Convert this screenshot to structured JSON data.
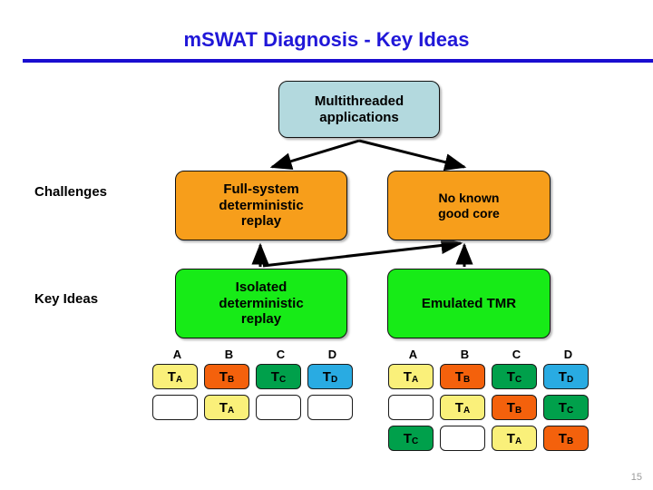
{
  "slide": {
    "title": "mSWAT Diagnosis - Key Ideas",
    "page_number": "15",
    "accent_color": "#2017D8"
  },
  "row_labels": {
    "challenges": "Challenges",
    "key_ideas": "Key Ideas"
  },
  "boxes": {
    "multithreaded": {
      "line1": "Multithreaded",
      "line2": "applications",
      "color": "#B3D9DE"
    },
    "full_system": {
      "line1": "Full-system",
      "line2": "deterministic",
      "line3": "replay",
      "color": "#F79E1B"
    },
    "no_known_core": {
      "line1": "No known",
      "line2": "good core",
      "color": "#F79E1B"
    },
    "isolated": {
      "line1": "Isolated",
      "line2": "deterministic",
      "line3": "replay",
      "color": "#17EB17"
    },
    "emulated_tmr": {
      "line1": "Emulated TMR",
      "color": "#17EB17"
    }
  },
  "grids": {
    "left": {
      "headers": [
        "A",
        "B",
        "C",
        "D"
      ],
      "rows": [
        [
          {
            "t": "T",
            "s": "A",
            "c": "c-A"
          },
          {
            "t": "T",
            "s": "B",
            "c": "c-B"
          },
          {
            "t": "T",
            "s": "C",
            "c": "c-C"
          },
          {
            "t": "T",
            "s": "D",
            "c": "c-D"
          }
        ],
        [
          {
            "t": "",
            "s": "",
            "c": "empty"
          },
          {
            "t": "T",
            "s": "A",
            "c": "c-A"
          },
          {
            "t": "",
            "s": "",
            "c": "empty"
          },
          {
            "t": "",
            "s": "",
            "c": "empty"
          }
        ]
      ]
    },
    "right": {
      "headers": [
        "A",
        "B",
        "C",
        "D"
      ],
      "rows": [
        [
          {
            "t": "T",
            "s": "A",
            "c": "c-A"
          },
          {
            "t": "T",
            "s": "B",
            "c": "c-B"
          },
          {
            "t": "T",
            "s": "C",
            "c": "c-C"
          },
          {
            "t": "T",
            "s": "D",
            "c": "c-D"
          }
        ],
        [
          {
            "t": "",
            "s": "",
            "c": "empty"
          },
          {
            "t": "T",
            "s": "A",
            "c": "c-A"
          },
          {
            "t": "T",
            "s": "B",
            "c": "c-B"
          },
          {
            "t": "T",
            "s": "C",
            "c": "c-C"
          }
        ],
        [
          {
            "t": "T",
            "s": "C",
            "c": "c-C"
          },
          {
            "t": "",
            "s": "",
            "c": "empty"
          },
          {
            "t": "T",
            "s": "A",
            "c": "c-A"
          },
          {
            "t": "T",
            "s": "B",
            "c": "c-B"
          }
        ]
      ]
    }
  },
  "arrows": [
    {
      "name": "arrow-apps-to-fullsystem"
    },
    {
      "name": "arrow-apps-to-nokerncore"
    },
    {
      "name": "arrow-isolated-to-fullsystem"
    },
    {
      "name": "arrow-isolated-to-nokerncore"
    },
    {
      "name": "arrow-tmr-to-nokerncore"
    }
  ]
}
